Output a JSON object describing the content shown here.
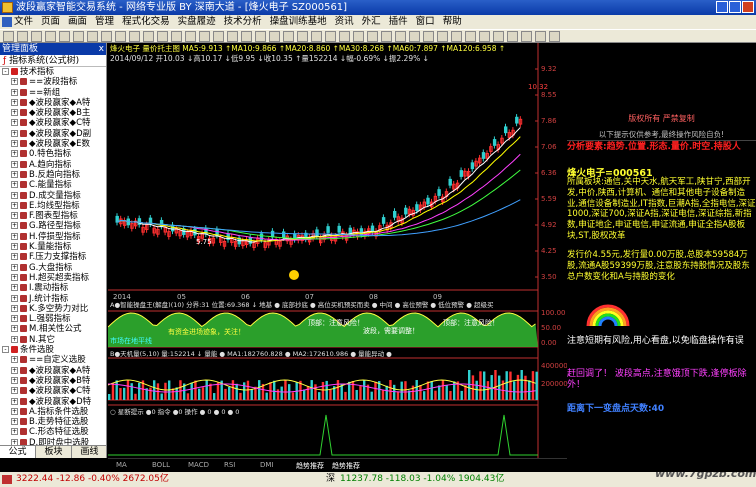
{
  "window": {
    "title": "波段赢家智能交易系统 - 网络专业版 BY 深南大道 - [烽火电子 SZ000561]"
  },
  "menu": [
    "文件",
    "页面",
    "画面",
    "管理",
    "程式化交易",
    "实盘履迹",
    "技术分析",
    "操盘训练基地",
    "资讯",
    "外汇",
    "插件",
    "窗口",
    "帮助"
  ],
  "panel": {
    "header": "管理面板",
    "close": "x",
    "title": "指标系统(公式树)",
    "items": [
      {
        "label": "技术指标",
        "level": 0,
        "box": "-",
        "icon": "folder"
      },
      {
        "label": "==波段指标",
        "level": 1,
        "box": "+"
      },
      {
        "label": "==新组",
        "level": 1,
        "box": "+"
      },
      {
        "label": "◆波段赢家◆A特",
        "level": 1,
        "box": "+"
      },
      {
        "label": "◆波段赢家◆B主",
        "level": 1,
        "box": "+"
      },
      {
        "label": "◆波段赢家◆C特",
        "level": 1,
        "box": "+"
      },
      {
        "label": "◆波段赢家◆D副",
        "level": 1,
        "box": "+"
      },
      {
        "label": "◆波段赢家◆E数",
        "level": 1,
        "box": "+"
      },
      {
        "label": "0.特色指标",
        "level": 1,
        "box": "+"
      },
      {
        "label": "A.趋向指标",
        "level": 1,
        "box": "+"
      },
      {
        "label": "B.反趋向指标",
        "level": 1,
        "box": "+"
      },
      {
        "label": "C.能量指标",
        "level": 1,
        "box": "+"
      },
      {
        "label": "D.成交量指标",
        "level": 1,
        "box": "+"
      },
      {
        "label": "E.均线型指标",
        "level": 1,
        "box": "+"
      },
      {
        "label": "F.图表型指标",
        "level": 1,
        "box": "+"
      },
      {
        "label": "G.路径型指标",
        "level": 1,
        "box": "+"
      },
      {
        "label": "H.停损型指标",
        "level": 1,
        "box": "+"
      },
      {
        "label": "K.量能指标",
        "level": 1,
        "box": "+"
      },
      {
        "label": "F.压力支撑指标",
        "level": 1,
        "box": "+"
      },
      {
        "label": "G.大盘指标",
        "level": 1,
        "box": "+"
      },
      {
        "label": "H.超买超卖指标",
        "level": 1,
        "box": "+"
      },
      {
        "label": "I.震动指标",
        "level": 1,
        "box": "+"
      },
      {
        "label": "J.统计指标",
        "level": 1,
        "box": "+"
      },
      {
        "label": "K.多空势力对比",
        "level": 1,
        "box": "+"
      },
      {
        "label": "L.强弱指标",
        "level": 1,
        "box": "+"
      },
      {
        "label": "M.相关性公式",
        "level": 1,
        "box": "+"
      },
      {
        "label": "N.其它",
        "level": 1,
        "box": "+"
      },
      {
        "label": "条件选股",
        "level": 0,
        "box": "-",
        "icon": "folder"
      },
      {
        "label": "==自定义选股",
        "level": 1,
        "box": "+"
      },
      {
        "label": "◆波段赢家◆A特",
        "level": 1,
        "box": "+"
      },
      {
        "label": "◆波段赢家◆B特",
        "level": 1,
        "box": "+"
      },
      {
        "label": "◆波段赢家◆C特",
        "level": 1,
        "box": "+"
      },
      {
        "label": "◆波段赢家◆D特",
        "level": 1,
        "box": "+"
      },
      {
        "label": "A.指标条件选股",
        "level": 1,
        "box": "+"
      },
      {
        "label": "B.走势特征选股",
        "level": 1,
        "box": "+"
      },
      {
        "label": "C.形态特征选股",
        "level": 1,
        "box": "+"
      },
      {
        "label": "D.即时盘中选股",
        "level": 1,
        "box": "+"
      },
      {
        "label": "E.基本面选股",
        "level": 1,
        "box": "+"
      },
      {
        "label": "交易系统",
        "level": 0,
        "box": "+",
        "icon": "folder"
      }
    ],
    "tabs": [
      "公式",
      "板块",
      "画线"
    ]
  },
  "chart": {
    "main_legend": "烽火电子 量价托主图 MA5:9.913 ↑MA10:9.866 ↑MA20:8.860 ↑MA30:8.268 ↑MA60:7.897 ↑MA120:6.958 ↑",
    "info_line": "2014/09/12 开10.03 ↓高10.17 ↓低9.95 ↓收10.35 ↑量152214 ↓幅-0.69% ↓振2.29% ↓",
    "price_scale": [
      "9.32",
      "8.55",
      "7.86",
      "7.06",
      "6.36",
      "5.59",
      "4.92",
      "4.25",
      "3.50"
    ],
    "high_tag": "10.32",
    "low_tag": "5.75",
    "dates": [
      "2014",
      "05",
      "06",
      "07",
      "08",
      "09"
    ],
    "p2_legend": "A●智能操盘王(解盘)(10) 分界:31 位置:69.368 ↓ 地基 ● 底部抄底 ● 高位买机预买而卖 ● 中间 ● 高位预警 ● 低位预警 ● 超级买",
    "p2_scale": [
      "100.00",
      "50.00",
      "0.00"
    ],
    "p2_notes": [
      "有资金进场迹象，关注！",
      "顶部：注意风险！",
      "波段，需要调整！",
      "顶部：注意风险！"
    ],
    "p2_left": "市场在地平线",
    "p3_legend": "B●天机量(5,10) 量:152214 ↓ 量能 ● MA1:182760.828 ● MA2:172610.986 ● 量能异动 ●",
    "p3_scale": [
      "400000",
      "200000"
    ],
    "p4_legend": "○ 星断提示 ●0 指令 ●0 操作 ● 0 ● 0 ● 0",
    "bottom_tabs": [
      "MA",
      "BOLL",
      "MACD",
      "RSI",
      "DMI",
      "趋势推荐",
      "趋势推荐"
    ],
    "chart_colors": {
      "up": "#ff3030",
      "down": "#30d0d0",
      "ma5": "#ffffff",
      "ma10": "#ffff00",
      "ma20": "#ff40ff",
      "ma30": "#40ff40"
    }
  },
  "right": {
    "head_red": "版权所有  严禁复制",
    "head_sub": "以下提示仅供参考,最终操作风险自负!",
    "keys": "分析要素:趋势.位置.形态.量价.时空.持股人",
    "stock": "烽火电子=000561",
    "desc": "所属板块:通信,关中天水,航天军工,陕甘宁,西部开发,中价,陕西,计算机、通信和其他电子设备制造业,通信设备制造业,IT指数,巨潮A指,全指电信,深证1000,深证700,深证A指,深证电信,深证综指,新指数,申证地企,申证电信,申证流通,申证全指A股板块,ST,股权改革",
    "issue": "发行价4.55元,发行量0.00万股,总股本59584万股,流通A股59399万股,注意股东持股情况及股东总户数变化和A与持股的变化",
    "risk": "注意短期有风险,用心看盘,以免临盘操作有误",
    "top": "赶回调了！ 波段高点,注意饿顶下跌,逢停板除外！",
    "bottom": "距离下一变盘点天数:40",
    "tabs": [
      "细",
      "价",
      "势"
    ]
  },
  "status": {
    "sh": "3222.44 -12.86 -0.40% 2672.05亿",
    "sz": "11237.78 -118.03 -1.04% 1904.43亿",
    "sz_label": "深",
    "watermark": "www.7gpzb.com"
  }
}
